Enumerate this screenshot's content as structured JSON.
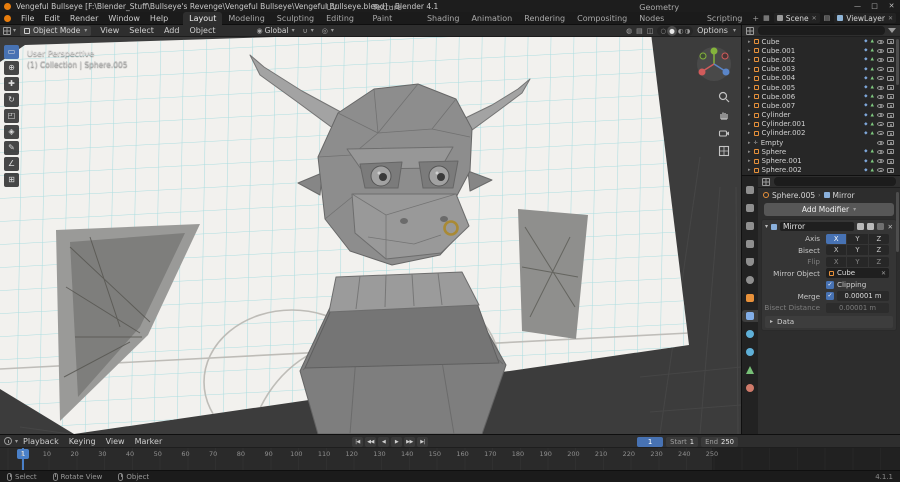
{
  "titlebar": {
    "title": "Vengeful Bullseye [F:\\Blender_Stuff\\Bullseye's Revenge\\Vengeful Bullseye\\Vengeful Bullseye.blend] - Blender 4.1",
    "window_buttons": {
      "minimize": "—",
      "maximize": "□",
      "close": "✕"
    }
  },
  "menubar": {
    "menus": [
      "File",
      "Edit",
      "Render",
      "Window",
      "Help"
    ],
    "workspaces": [
      "Layout",
      "Modeling",
      "Sculpting",
      "UV Editing",
      "Texture Paint",
      "Shading",
      "Animation",
      "Rendering",
      "Compositing",
      "Geometry Nodes",
      "Scripting"
    ],
    "active_workspace": "Layout",
    "add_workspace": "+",
    "scene_label": "Scene",
    "viewlayer_label": "ViewLayer"
  },
  "toolheader": {
    "mode": "Object Mode",
    "menus": [
      "View",
      "Select",
      "Add",
      "Object"
    ],
    "orientation": "Global",
    "options_label": "Options"
  },
  "viewport": {
    "overlay_line1": "User Perspective",
    "overlay_line2": "(1) Collection | Sphere.005",
    "tools": [
      {
        "name": "select-box",
        "glyph": "▭",
        "active": true
      },
      {
        "name": "cursor",
        "glyph": "⊕"
      },
      {
        "name": "move",
        "glyph": "✚"
      },
      {
        "name": "rotate",
        "glyph": "↻"
      },
      {
        "name": "scale",
        "glyph": "◰"
      },
      {
        "name": "transform",
        "glyph": "◈"
      },
      {
        "name": "annotate",
        "glyph": "✎"
      },
      {
        "name": "measure",
        "glyph": "∠"
      },
      {
        "name": "add-cube",
        "glyph": "⊞"
      }
    ]
  },
  "outliner": {
    "items": [
      {
        "name": "Cube",
        "type": "mesh"
      },
      {
        "name": "Cube.001",
        "type": "mesh"
      },
      {
        "name": "Cube.002",
        "type": "mesh"
      },
      {
        "name": "Cube.003",
        "type": "mesh"
      },
      {
        "name": "Cube.004",
        "type": "mesh"
      },
      {
        "name": "Cube.005",
        "type": "mesh"
      },
      {
        "name": "Cube.006",
        "type": "mesh"
      },
      {
        "name": "Cube.007",
        "type": "mesh"
      },
      {
        "name": "Cylinder",
        "type": "mesh"
      },
      {
        "name": "Cylinder.001",
        "type": "mesh"
      },
      {
        "name": "Cylinder.002",
        "type": "mesh"
      },
      {
        "name": "Empty",
        "type": "empty"
      },
      {
        "name": "Sphere",
        "type": "mesh"
      },
      {
        "name": "Sphere.001",
        "type": "mesh"
      },
      {
        "name": "Sphere.002",
        "type": "mesh"
      }
    ]
  },
  "properties": {
    "tabs": [
      {
        "name": "tool"
      },
      {
        "name": "render"
      },
      {
        "name": "output"
      },
      {
        "name": "viewlayer"
      },
      {
        "name": "scene"
      },
      {
        "name": "world"
      },
      {
        "name": "object"
      },
      {
        "name": "modifiers",
        "active": true
      },
      {
        "name": "particles"
      },
      {
        "name": "physics"
      },
      {
        "name": "data"
      },
      {
        "name": "material"
      }
    ],
    "breadcrumb": {
      "object": "Sphere.005",
      "separator": "›",
      "modifier": "Mirror"
    },
    "add_modifier_label": "Add Modifier",
    "modifier": {
      "name": "Mirror",
      "axis_label": "Axis",
      "bisect_label": "Bisect",
      "flip_label": "Flip",
      "axis_options": [
        "X",
        "Y",
        "Z"
      ],
      "axis_active": [
        "X"
      ],
      "bisect_active": [],
      "flip_active": [],
      "mirror_object_label": "Mirror Object",
      "mirror_object_value": "Cube",
      "clipping_label": "Clipping",
      "clipping_checked": true,
      "merge_label": "Merge",
      "merge_checked": true,
      "merge_value": "0.00001 m",
      "bisect_distance_label": "Bisect Distance",
      "bisect_distance_value": "0.00001 m",
      "data_section_label": "Data"
    }
  },
  "timeline": {
    "menus": [
      "Playback",
      "Keying",
      "View",
      "Marker"
    ],
    "transport": [
      {
        "name": "jump-to-start",
        "glyph": "|◀"
      },
      {
        "name": "prev-keyframe",
        "glyph": "◀◀"
      },
      {
        "name": "play-reverse",
        "glyph": "◀"
      },
      {
        "name": "play",
        "glyph": "▶"
      },
      {
        "name": "next-keyframe",
        "glyph": "▶▶"
      },
      {
        "name": "jump-to-end",
        "glyph": "▶|"
      }
    ],
    "current_frame": "1",
    "start_label": "Start",
    "start_value": "1",
    "end_label": "End",
    "end_value": "250",
    "ticks": [
      "1",
      "10",
      "20",
      "30",
      "40",
      "50",
      "60",
      "70",
      "80",
      "90",
      "100",
      "110",
      "120",
      "130",
      "140",
      "150",
      "160",
      "170",
      "180",
      "190",
      "200",
      "210",
      "220",
      "230",
      "240",
      "250"
    ]
  },
  "statusbar": {
    "items": [
      {
        "label": "Select"
      },
      {
        "label": "Rotate View"
      },
      {
        "label": "Object"
      }
    ],
    "version": "4.1.1"
  },
  "colors": {
    "accent_blue": "#4772b3",
    "object_orange": "#e8913a",
    "grid_cyan": "#abdde0",
    "nose_ring_gold": "#a98a35"
  }
}
